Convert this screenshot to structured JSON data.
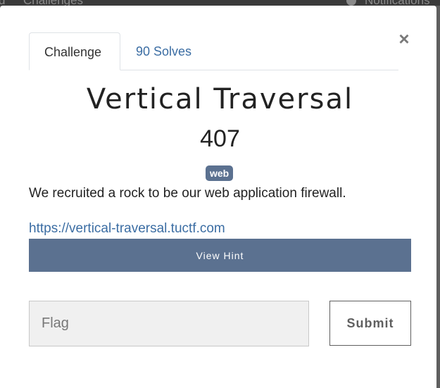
{
  "backdrop": {
    "left_cut": "d",
    "challenges": "Challenges",
    "notifications": "Notifications"
  },
  "modal": {
    "close_symbol": "×",
    "tabs": [
      {
        "label": "Challenge",
        "active": true
      },
      {
        "label": "90 Solves",
        "active": false
      }
    ],
    "challenge": {
      "name": "Vertical Traversal",
      "points": "407",
      "tag": "web",
      "description": "We recruited a rock to be our web application firewall.",
      "link": "https://vertical-traversal.tuctf.com"
    },
    "hint_button": "View Hint",
    "flag_input": {
      "placeholder": "Flag",
      "value": ""
    },
    "submit_button": "Submit"
  },
  "colors": {
    "accent": "#5b7190",
    "link": "#3b6da3",
    "overlay": "#5f5f5f"
  },
  "icons": {
    "close": "close-icon",
    "bell": "bell-icon"
  }
}
